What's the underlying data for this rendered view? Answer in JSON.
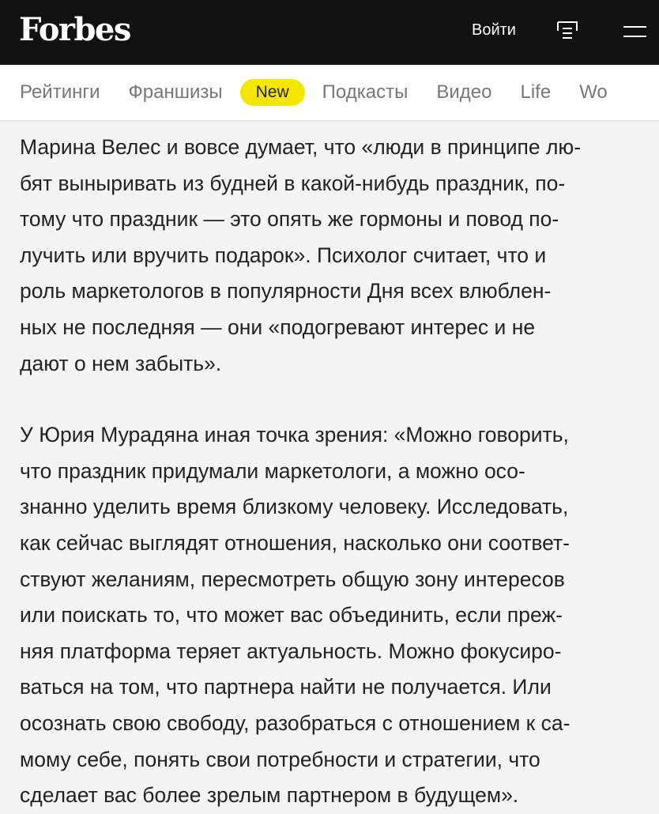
{
  "header": {
    "logo": "Forbes",
    "login_label": "Войти",
    "magazine_icon": "magazine-icon",
    "menu_icon": "hamburger-icon"
  },
  "nav": {
    "items": [
      "Рейтинги",
      "Франшизы",
      "New",
      "Подкасты",
      "Видео",
      "Life",
      "Wo"
    ]
  },
  "article": {
    "paragraphs": [
      [
        "Марина Велес и вовсе думает, что «люди в принципе лю-",
        "бят выныривать из будней в какой-нибудь праздник, по-",
        "тому что праздник — это опять же гормоны и повод по-",
        "лучить или вручить подарок». Психолог считает, что и",
        "роль маркетологов в популярности Дня всех влюблен-",
        "ных не последняя — они «подогревают интерес и не",
        "дают о нем забыть»."
      ],
      [
        "У Юрия Мурадяна иная точка зрения: «Можно говорить,",
        "что праздник придумали маркетологи, а можно осо-",
        "знанно уделить время близкому человеку. Исследовать,",
        "как сейчас выглядят отношения, насколько они соответ-",
        "ствуют желаниям, пересмотреть общую зону интересов",
        "или поискать то, что может вас объединить, если преж-",
        "няя платформа теряет актуальность. Можно фокусиро-",
        "ваться на том, что партнера найти не получается. Или",
        "осознать свою свободу, разобраться с отношением к са-",
        "мому себе, понять свои потребности и стратегии, что",
        "сделает вас более зрелым партнером в будущем»."
      ]
    ]
  }
}
